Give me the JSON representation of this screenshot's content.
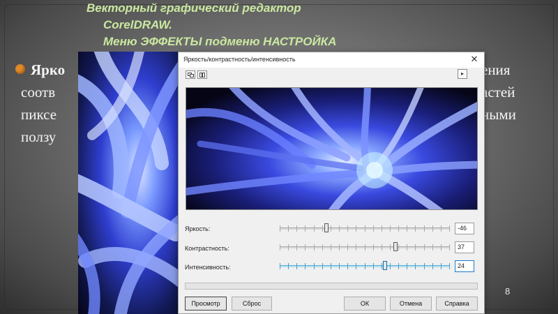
{
  "slide": {
    "title_line1": "Векторный графический редактор",
    "title_line2": "CorelDRAW.",
    "title_line3": "Меню ЭФФЕКТЫ подменю НАСТРОЙКА",
    "body_lead_bold": "Ярко",
    "body_line2": "соотв",
    "body_line3": "пиксе",
    "body_line4": "ползу",
    "body_right1": "ения",
    "body_right2": "астей",
    "body_right3": "ными",
    "page_number": "8"
  },
  "dialog": {
    "title": "Яркость/контрастность/интенсивность",
    "close_glyph": "✕",
    "arrow_glyph": "▸",
    "rows": [
      {
        "label": "Яркость:",
        "value": "-46",
        "level": -46
      },
      {
        "label": "Контрастность:",
        "value": "37",
        "level": 37
      },
      {
        "label": "Интенсивность:",
        "value": "24",
        "level": 24
      }
    ],
    "buttons": {
      "preview": "Просмотр",
      "reset": "Сброс",
      "ok": "ОК",
      "cancel": "Отмена",
      "help": "Справка"
    }
  },
  "colors": {
    "title_green": "#cbe8a0",
    "bullet_orange": "#e08a2a",
    "focus_blue": "#1a7ad0"
  }
}
